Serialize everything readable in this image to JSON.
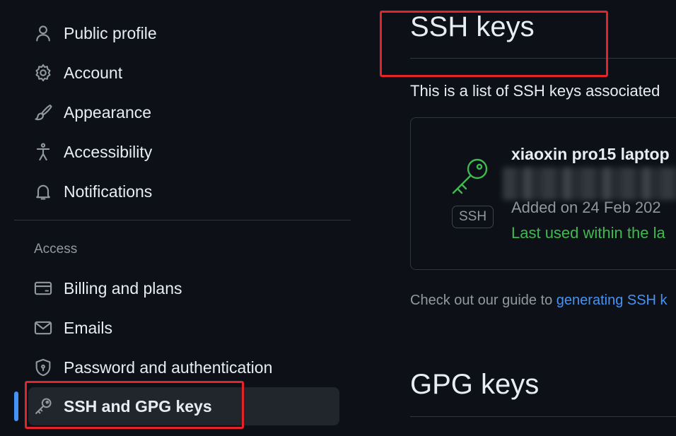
{
  "sidebar": {
    "items": [
      {
        "label": "Public profile",
        "icon": "person-icon"
      },
      {
        "label": "Account",
        "icon": "gear-icon"
      },
      {
        "label": "Appearance",
        "icon": "paintbrush-icon"
      },
      {
        "label": "Accessibility",
        "icon": "accessibility-icon"
      },
      {
        "label": "Notifications",
        "icon": "bell-icon"
      }
    ],
    "access_group_label": "Access",
    "access_items": [
      {
        "label": "Billing and plans",
        "icon": "credit-card-icon"
      },
      {
        "label": "Emails",
        "icon": "mail-icon"
      },
      {
        "label": "Password and authentication",
        "icon": "shield-lock-icon"
      },
      {
        "label": "SSH and GPG keys",
        "icon": "key-icon",
        "active": true
      }
    ]
  },
  "main": {
    "ssh_heading": "SSH keys",
    "ssh_description": "This is a list of SSH keys associated",
    "key": {
      "title": "xiaoxin pro15 laptop",
      "badge": "SSH",
      "added": "Added on 24 Feb 202",
      "last_used": "Last used within the la"
    },
    "guide_prefix": "Check out our guide to ",
    "guide_link": "generating SSH k",
    "gpg_heading": "GPG keys"
  },
  "colors": {
    "background": "#0d1117",
    "text": "#e6edf3",
    "muted": "#9198a1",
    "accent": "#4493f8",
    "success": "#3fb950",
    "highlight": "#e3242b"
  }
}
